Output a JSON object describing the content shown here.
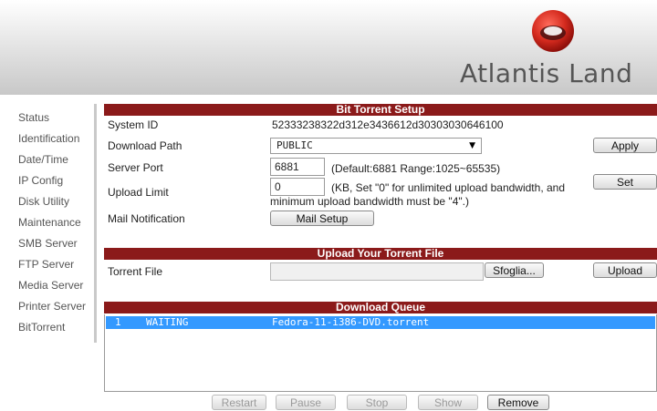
{
  "brand": {
    "logo_text": "Atlantis Land"
  },
  "sidebar": {
    "items": [
      {
        "label": "Status"
      },
      {
        "label": "Identification"
      },
      {
        "label": "Date/Time"
      },
      {
        "label": "IP Config"
      },
      {
        "label": "Disk Utility"
      },
      {
        "label": "Maintenance"
      },
      {
        "label": "SMB Server"
      },
      {
        "label": "FTP Server"
      },
      {
        "label": "Media Server"
      },
      {
        "label": "Printer Server"
      },
      {
        "label": "BitTorrent"
      }
    ]
  },
  "setup": {
    "title": "Bit Torrent Setup",
    "system_id_label": "System ID",
    "system_id_value": "52333238322d312e3436612d30303030646100",
    "download_path_label": "Download Path",
    "download_path_value": "PUBLIC",
    "apply_label": "Apply",
    "server_port_label": "Server Port",
    "server_port_value": "6881",
    "server_port_hint": "(Default:6881  Range:1025~65535)",
    "upload_limit_label": "Upload Limit",
    "upload_limit_value": "0",
    "upload_limit_hint_1": "(KB, Set \"0\" for unlimited upload bandwidth, and",
    "upload_limit_hint_2": "minimum upload bandwidth must be \"4\".)",
    "set_label": "Set",
    "mail_notification_label": "Mail Notification",
    "mail_setup_label": "Mail Setup"
  },
  "upload": {
    "title": "Upload Your Torrent File",
    "torrent_file_label": "Torrent File",
    "browse_label": "Sfoglia...",
    "upload_label": "Upload"
  },
  "queue": {
    "title": "Download Queue",
    "rows": [
      {
        "index": "1",
        "status": "WAITING",
        "name": "Fedora-11-i386-DVD.torrent"
      }
    ]
  },
  "actions": {
    "restart": "Restart",
    "pause": "Pause",
    "stop": "Stop",
    "show": "Show",
    "remove": "Remove"
  },
  "colors": {
    "section_bar": "#8b1a1a",
    "selection": "#3399ff",
    "logo_red": "#cc2222"
  }
}
